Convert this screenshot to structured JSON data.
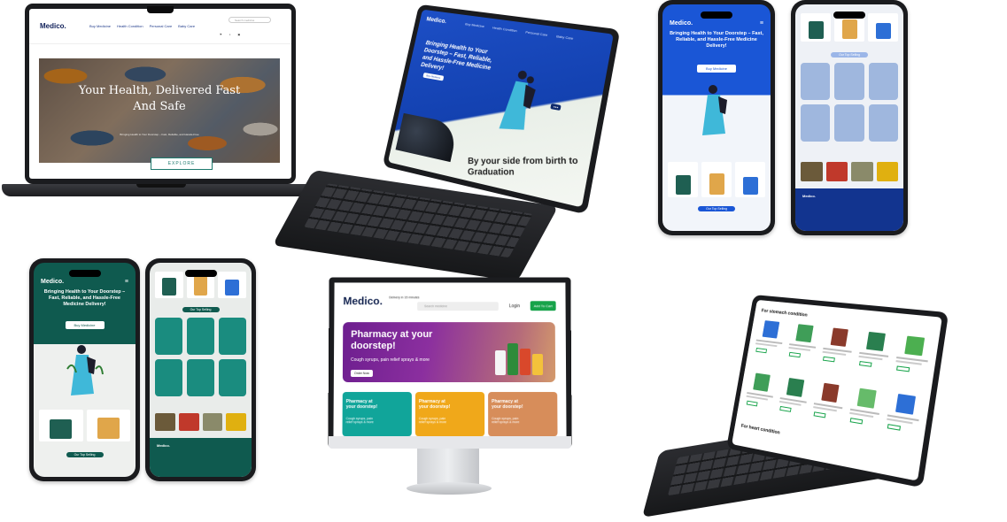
{
  "colors": {
    "laptop_teal": "#1e7a6e",
    "blue_brand": "#1a56d6",
    "green_brand": "#0f5a4f",
    "monitor_hero_purple": "#6d1e8f",
    "cart_green": "#17a34a",
    "card_teal": "#11a59a",
    "card_yellow": "#f0a81a",
    "card_peach": "#d78d5a"
  },
  "laptop": {
    "logo": "Medico.",
    "nav": [
      "Buy Medicine",
      "Health Condition",
      "Personal Care",
      "Baby Care"
    ],
    "search_placeholder": "Search medicine",
    "hero_title_line1": "Your Health, Delivered Fast",
    "hero_title_line2": "And Safe",
    "hero_sub": "Bringing Health to Your Doorstep – Fast, Reliable, and Hassle-Free",
    "explore_label": "EXPLORE"
  },
  "tablet1": {
    "logo": "Medico.",
    "nav": [
      "Buy Medicine",
      "Health Condition",
      "Personal Care",
      "Baby Care"
    ],
    "title": "Bringing Health to Your Doorstep – Fast, Reliable, and Hassle-Free Medicine Delivery!",
    "button": "Buy Medicine",
    "slogan": "By your side from birth to Graduation"
  },
  "phone_blue": {
    "logo": "Medico.",
    "title": "Bringing Health to Your Doorstep – Fast, Reliable, and Hassle-Free Medicine Delivery!",
    "button": "Buy Medicine",
    "section": "Our Top Selling"
  },
  "phone_green": {
    "logo": "Medico.",
    "title": "Bringing Health to Your Doorstep – Fast, Reliable, and Hassle-Free Medicine Delivery!",
    "button": "Buy Medicine",
    "section": "Our Top Selling"
  },
  "monitor": {
    "logo": "Medico.",
    "tagline": "Delivery in 15 minutes",
    "search_placeholder": "Search medicine",
    "login": "Login",
    "cart": "Add To Cart",
    "hero_title": "Pharmacy at your doorstep!",
    "hero_sub": "Cough syrups, pain relief sprays & more",
    "hero_button": "Order Now",
    "cards": [
      {
        "title": "Pharmacy at your doorstep!",
        "sub": "Cough syrups, pain relief sprays & more"
      },
      {
        "title": "Pharmacy at your doorstep!",
        "sub": "Cough syrups, pain relief sprays & more"
      },
      {
        "title": "Pharmacy at your doorstep!",
        "sub": "Cough syrups, pain relief sprays & more"
      }
    ]
  },
  "tablet2": {
    "heading1": "For stomach condition",
    "heading2": "For heart condition"
  }
}
